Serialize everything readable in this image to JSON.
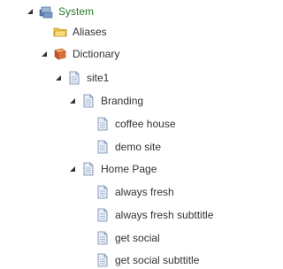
{
  "tree": {
    "system": {
      "label": "System",
      "icon": "system-folder-icon",
      "expanded": true,
      "color": "#2a7a2a"
    },
    "aliases": {
      "label": "Aliases",
      "icon": "folder-icon"
    },
    "dictionary": {
      "label": "Dictionary",
      "icon": "book-icon",
      "expanded": true
    },
    "site1": {
      "label": "site1",
      "icon": "document-icon",
      "expanded": true
    },
    "branding": {
      "label": "Branding",
      "icon": "document-icon",
      "expanded": true
    },
    "coffee_house": {
      "label": "coffee house",
      "icon": "document-icon"
    },
    "demo_site": {
      "label": "demo site",
      "icon": "document-icon"
    },
    "home_page": {
      "label": "Home Page",
      "icon": "document-icon",
      "expanded": true
    },
    "always_fresh": {
      "label": "always fresh",
      "icon": "document-icon"
    },
    "always_fresh_subttitle": {
      "label": "always fresh subttitle",
      "icon": "document-icon"
    },
    "get_social": {
      "label": "get social",
      "icon": "document-icon"
    },
    "get_social_subttitle": {
      "label": "get social subttitle",
      "icon": "document-icon"
    }
  }
}
